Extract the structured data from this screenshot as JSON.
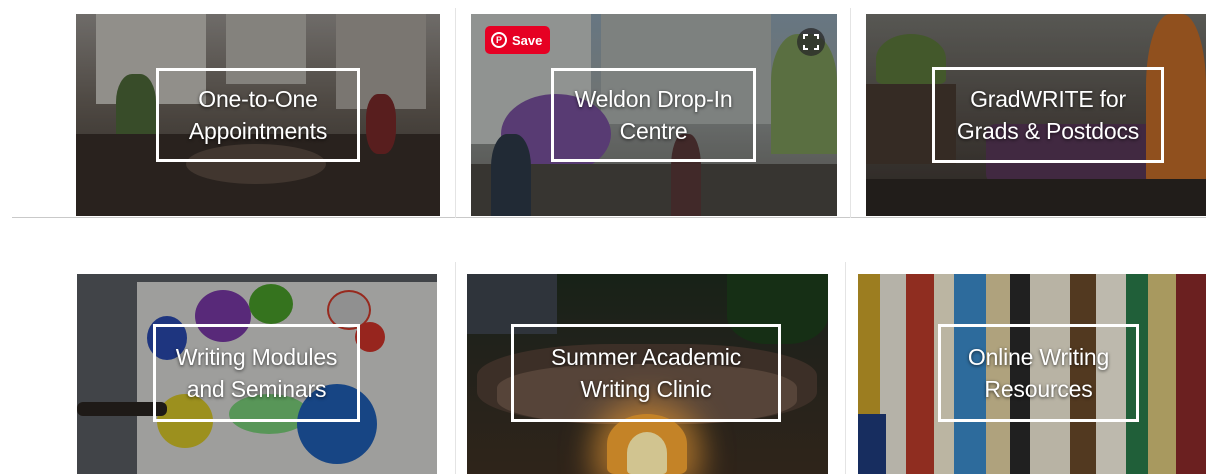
{
  "tiles": [
    {
      "id": "appointments",
      "line1": "One-to-One",
      "line2": "Appointments"
    },
    {
      "id": "weldon",
      "line1": "Weldon Drop-In",
      "line2": "Centre"
    },
    {
      "id": "gradwrite",
      "line1": "GradWRITE for",
      "line2": "Grads & Postdocs"
    },
    {
      "id": "modules",
      "line1": "Writing Modules",
      "line2": "and Seminars"
    },
    {
      "id": "clinic",
      "line1": "Summer Academic",
      "line2": "Writing Clinic"
    },
    {
      "id": "resources",
      "line1": "Online Writing",
      "line2": "Resources"
    }
  ],
  "pinterest": {
    "save_label": "Save",
    "pin_glyph": "P",
    "brand_color": "#e60023",
    "save_icon": "pinterest-icon",
    "expand_icon": "expand-icon"
  }
}
